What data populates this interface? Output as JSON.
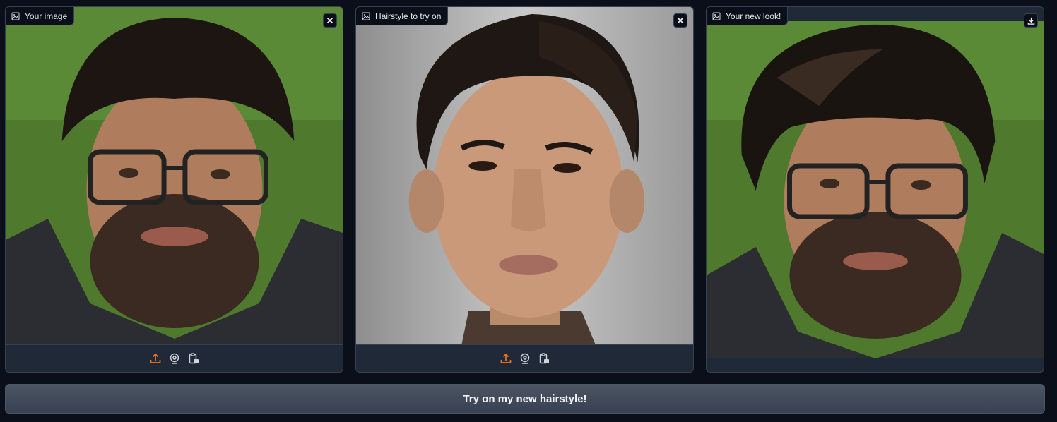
{
  "panels": [
    {
      "label": "Your image",
      "corner_icon": "close-icon",
      "toolbar": [
        "upload-icon",
        "webcam-icon",
        "clipboard-icon"
      ]
    },
    {
      "label": "Hairstyle to try on",
      "corner_icon": "close-icon",
      "toolbar": [
        "upload-icon",
        "webcam-icon",
        "clipboard-icon"
      ]
    },
    {
      "label": "Your new look!",
      "corner_icon": "download-icon",
      "toolbar": []
    }
  ],
  "submit": {
    "label": "Try on my new hairstyle!"
  },
  "colors": {
    "accent": "#f97316",
    "icon": "#d1d5db",
    "background": "#0b0f19",
    "panel": "#1f2937"
  }
}
